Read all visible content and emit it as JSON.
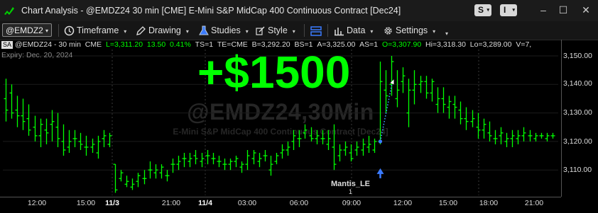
{
  "titlebar": {
    "title": "Chart Analysis - @EMDZ24 30 min [CME] E-Mini S&P MidCap 400 Continuous Contract [Dec24]",
    "badge_s": "S",
    "badge_i": "I"
  },
  "toolbar": {
    "symbol": "@EMDZ2",
    "timeframe": "Timeframe",
    "drawing": "Drawing",
    "studies": "Studies",
    "style": "Style",
    "data": "Data",
    "settings": "Settings"
  },
  "infobar": {
    "sa": "SA",
    "symbol": "@EMDZ24 - 30 min",
    "exchange": "CME",
    "last": "L=3,311.20",
    "change": "13.50",
    "pct": "0.41%",
    "ts": "TS=1",
    "te": "TE=CME",
    "bid": "B=3,292.20",
    "bs": "BS=1",
    "ask": "A=3,325.00",
    "as": "AS=1",
    "open": "O=3,307.90",
    "high": "Hi=3,318.30",
    "low": "Lo=3,289.00",
    "vol": "V=7,"
  },
  "expiry": "Expiry: Dec. 20, 2024",
  "watermark": {
    "line1": "@EMDZ24,30Min",
    "line2": "E-Mini S&P MidCap 400 Continuous Contract [Dec24]"
  },
  "pnl_label": "+$1500",
  "trade": {
    "label": "Mantis_LE",
    "qty": "1",
    "entry_price": 3120,
    "exit_price": 3141
  },
  "colors": {
    "bar": "#00ff00",
    "pnl": "#00ff00",
    "entry_arrow": "#3b7bff",
    "grid": "#3a3a3a",
    "background": "#000000"
  },
  "y_axis": {
    "ticks": [
      "3,150.00",
      "3,140.00",
      "3,130.00",
      "3,120.00",
      "3,110.00"
    ]
  },
  "x_axis": {
    "ticks": [
      {
        "label": "12:00",
        "bold": false
      },
      {
        "label": "15:00",
        "bold": false
      },
      {
        "label": "11/3",
        "bold": true
      },
      {
        "label": "21:00",
        "bold": false
      },
      {
        "label": "11/4",
        "bold": true
      },
      {
        "label": "03:00",
        "bold": false
      },
      {
        "label": "06:00",
        "bold": false
      },
      {
        "label": "09:00",
        "bold": false
      },
      {
        "label": "12:00",
        "bold": false
      },
      {
        "label": "15:00",
        "bold": false
      },
      {
        "label": "18:00",
        "bold": false
      },
      {
        "label": "21:00",
        "bold": false
      }
    ]
  },
  "chart_data": {
    "type": "ohlc",
    "ylim": [
      3105,
      3153
    ],
    "bars": [
      [
        3135,
        3142,
        3127,
        3131
      ],
      [
        3137,
        3140,
        3128,
        3130
      ],
      [
        3131,
        3136,
        3125,
        3129
      ],
      [
        3129,
        3135,
        3124,
        3127
      ],
      [
        3128,
        3133,
        3122,
        3124
      ],
      [
        3125,
        3129,
        3120,
        3122
      ],
      [
        3122,
        3128,
        3118,
        3126
      ],
      [
        3124,
        3128,
        3119,
        3123
      ],
      [
        3126,
        3131,
        3120,
        3127
      ],
      [
        3125,
        3130,
        3118,
        3121
      ],
      [
        3120,
        3126,
        3115,
        3117
      ],
      [
        3118,
        3124,
        3116,
        3120
      ],
      [
        3121,
        3124,
        3118,
        3121
      ],
      [
        3120,
        3123,
        3117,
        3119
      ],
      [
        3118,
        3122,
        3115,
        3118
      ],
      [
        3118,
        3121,
        3116,
        3119
      ],
      [
        3116,
        3122,
        3114,
        3120
      ],
      [
        3121,
        3124,
        3118,
        3122
      ],
      [
        3119,
        3123,
        3118,
        3122
      ],
      [
        3112,
        3112,
        3102,
        3103
      ],
      [
        3107,
        3110,
        3106,
        3109
      ],
      [
        3105,
        3108,
        3104,
        3106
      ],
      [
        3104,
        3107,
        3103,
        3105
      ],
      [
        3106,
        3109,
        3104,
        3108
      ],
      [
        3107,
        3110,
        3105,
        3107
      ],
      [
        3110,
        3113,
        3107,
        3110
      ],
      [
        3109,
        3112,
        3107,
        3110
      ],
      [
        3109,
        3112,
        3107,
        3111
      ],
      [
        3108,
        3110,
        3106,
        3108
      ],
      [
        3112,
        3114,
        3109,
        3112
      ],
      [
        3112,
        3115,
        3110,
        3113
      ],
      [
        3114,
        3116,
        3111,
        3114
      ],
      [
        3113,
        3116,
        3111,
        3114
      ],
      [
        3115,
        3117,
        3112,
        3114
      ],
      [
        3113,
        3116,
        3111,
        3114
      ],
      [
        3115,
        3117,
        3112,
        3115
      ],
      [
        3114,
        3116,
        3112,
        3114
      ],
      [
        3113,
        3115,
        3111,
        3113
      ],
      [
        3112,
        3114,
        3110,
        3112
      ],
      [
        3112,
        3114,
        3110,
        3113
      ],
      [
        3113,
        3115,
        3111,
        3114
      ],
      [
        3111,
        3113,
        3109,
        3112
      ],
      [
        3112,
        3117,
        3110,
        3115
      ],
      [
        3114,
        3117,
        3112,
        3116
      ],
      [
        3113,
        3116,
        3111,
        3114
      ],
      [
        3115,
        3117,
        3113,
        3115
      ],
      [
        3110,
        3115,
        3108,
        3112
      ],
      [
        3113,
        3116,
        3112,
        3115
      ],
      [
        3116,
        3119,
        3114,
        3117
      ],
      [
        3117,
        3120,
        3115,
        3118
      ],
      [
        3120,
        3124,
        3117,
        3122
      ],
      [
        3121,
        3124,
        3118,
        3121
      ],
      [
        3123,
        3126,
        3121,
        3124
      ],
      [
        3122,
        3125,
        3120,
        3121
      ],
      [
        3121,
        3124,
        3119,
        3122
      ],
      [
        3121,
        3124,
        3119,
        3121
      ],
      [
        3119,
        3124,
        3117,
        3121
      ],
      [
        3118,
        3126,
        3110,
        3112
      ],
      [
        3115,
        3119,
        3113,
        3117
      ],
      [
        3117,
        3120,
        3115,
        3118
      ],
      [
        3116,
        3119,
        3113,
        3114
      ],
      [
        3117,
        3120,
        3115,
        3118
      ],
      [
        3117,
        3121,
        3115,
        3119
      ],
      [
        3118,
        3122,
        3116,
        3119
      ],
      [
        3117,
        3121,
        3116,
        3120
      ],
      [
        3120,
        3148,
        3119,
        3141
      ],
      [
        3138,
        3145,
        3130,
        3136
      ],
      [
        3140,
        3150,
        3136,
        3148
      ],
      [
        3135,
        3145,
        3132,
        3138
      ],
      [
        3141,
        3146,
        3137,
        3143
      ],
      [
        3130,
        3142,
        3125,
        3138
      ],
      [
        3138,
        3145,
        3133,
        3140
      ],
      [
        3140,
        3143,
        3137,
        3141
      ],
      [
        3141,
        3143,
        3135,
        3137
      ],
      [
        3137,
        3142,
        3134,
        3141
      ],
      [
        3133,
        3139,
        3130,
        3135
      ],
      [
        3135,
        3139,
        3130,
        3133
      ],
      [
        3132,
        3136,
        3128,
        3134
      ],
      [
        3133,
        3136,
        3128,
        3132
      ],
      [
        3131,
        3134,
        3126,
        3128
      ],
      [
        3128,
        3132,
        3124,
        3127
      ],
      [
        3127,
        3131,
        3125,
        3128
      ],
      [
        3125,
        3130,
        3121,
        3124
      ],
      [
        3124,
        3128,
        3121,
        3126
      ],
      [
        3123,
        3127,
        3120,
        3122
      ],
      [
        3121,
        3124,
        3119,
        3121
      ],
      [
        3122,
        3125,
        3119,
        3123
      ],
      [
        3120,
        3123,
        3118,
        3121
      ],
      [
        3121,
        3124,
        3118,
        3122
      ],
      [
        3121,
        3124,
        3119,
        3122
      ],
      [
        3122,
        3125,
        3120,
        3123
      ],
      [
        3122,
        3124,
        3120,
        3122
      ],
      [
        3121,
        3123,
        3120,
        3122
      ],
      [
        3122,
        3123,
        3121,
        3122
      ],
      [
        3121,
        3123,
        3120,
        3122
      ],
      [
        3122,
        3123,
        3121,
        3122
      ]
    ]
  }
}
